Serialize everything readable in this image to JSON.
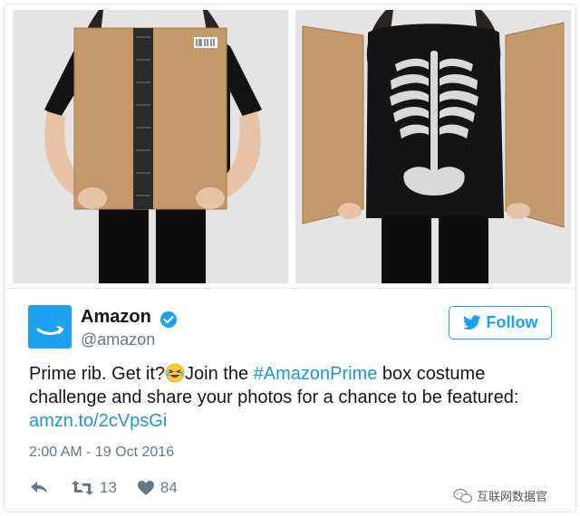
{
  "tweet": {
    "author_name": "Amazon",
    "author_handle": "@amazon",
    "follow_label": "Follow",
    "text": {
      "line1_before": "Prime rib. Get it?",
      "line1_mid": "Join the ",
      "hashtag": "#AmazonPrime",
      "line1_after": " box costume",
      "line2": "challenge and share your photos for a chance to be featured:",
      "link": "amzn.to/2cVpsGi"
    },
    "timestamp": "2:00 AM - 19 Oct 2016",
    "retweet_count": "13",
    "like_count": "84"
  },
  "watermark": {
    "text": "互联网数据官"
  },
  "colors": {
    "accent": "#1da1f2",
    "link": "#1b95e0",
    "text": "#14171a",
    "muted": "#657786",
    "cardboard": "#c49a6c"
  },
  "icons": {
    "verified": "verified-badge-icon",
    "follow": "twitter-bird-icon",
    "reply": "reply-arrow-icon",
    "retweet": "retweet-icon",
    "like": "heart-icon",
    "emoji": "laughing-tears-emoji"
  }
}
